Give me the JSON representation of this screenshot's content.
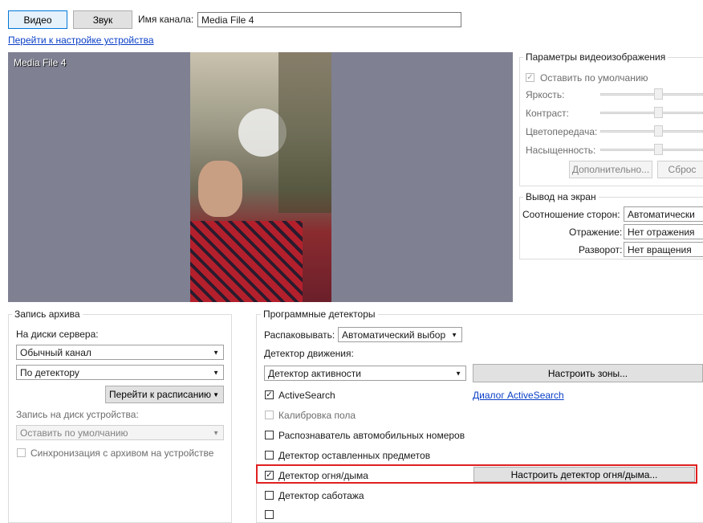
{
  "toolbar": {
    "video_tab": "Видео",
    "sound_tab": "Звук",
    "channel_name_label": "Имя канала:",
    "channel_name_value": "Media File 4",
    "device_settings_link": "Перейти к настройке устройства"
  },
  "video": {
    "overlay_title": "Media File 4"
  },
  "image_params": {
    "title": "Параметры видеоизображения",
    "default_checkbox": "Оставить по умолчанию",
    "default_checked": true,
    "brightness": "Яркость:",
    "contrast": "Контраст:",
    "color": "Цветопередача:",
    "saturation": "Насыщенность:",
    "more_button": "Дополнительно...",
    "reset_button": "Сброс"
  },
  "display": {
    "title": "Вывод на экран",
    "aspect_label": "Соотношение сторон:",
    "aspect_value": "Автоматически",
    "mirror_label": "Отражение:",
    "mirror_value": "Нет отражения",
    "rotate_label": "Разворот:",
    "rotate_value": "Нет вращения"
  },
  "archive": {
    "title": "Запись архива",
    "server_disks_label": "На диски сервера:",
    "channel_value": "Обычный канал",
    "mode_value": "По детектору",
    "schedule_button": "Перейти к расписанию",
    "device_disk_label": "Запись на диск устройства:",
    "device_disk_value": "Оставить по умолчанию",
    "sync_checkbox": "Синхронизация с архивом на устройстве"
  },
  "detectors": {
    "title": "Программные детекторы",
    "unpack_label": "Распаковывать:",
    "unpack_value": "Автоматический выбор",
    "motion_label": "Детектор движения:",
    "motion_value": "Детектор активности",
    "zones_button": "Настроить зоны...",
    "activesearch": "ActiveSearch",
    "activesearch_link": "Диалог ActiveSearch",
    "floor_calibration": "Калибровка пола",
    "plates": "Распознаватель автомобильных номеров",
    "left_objects": "Детектор оставленных предметов",
    "fire_smoke": "Детектор огня/дыма",
    "fire_smoke_button": "Настроить детектор огня/дыма...",
    "sabotage": "Детектор саботажа"
  },
  "colors": {
    "highlight": "#e02020",
    "video_bg": "#7f8092",
    "link": "#0a3fc7"
  }
}
